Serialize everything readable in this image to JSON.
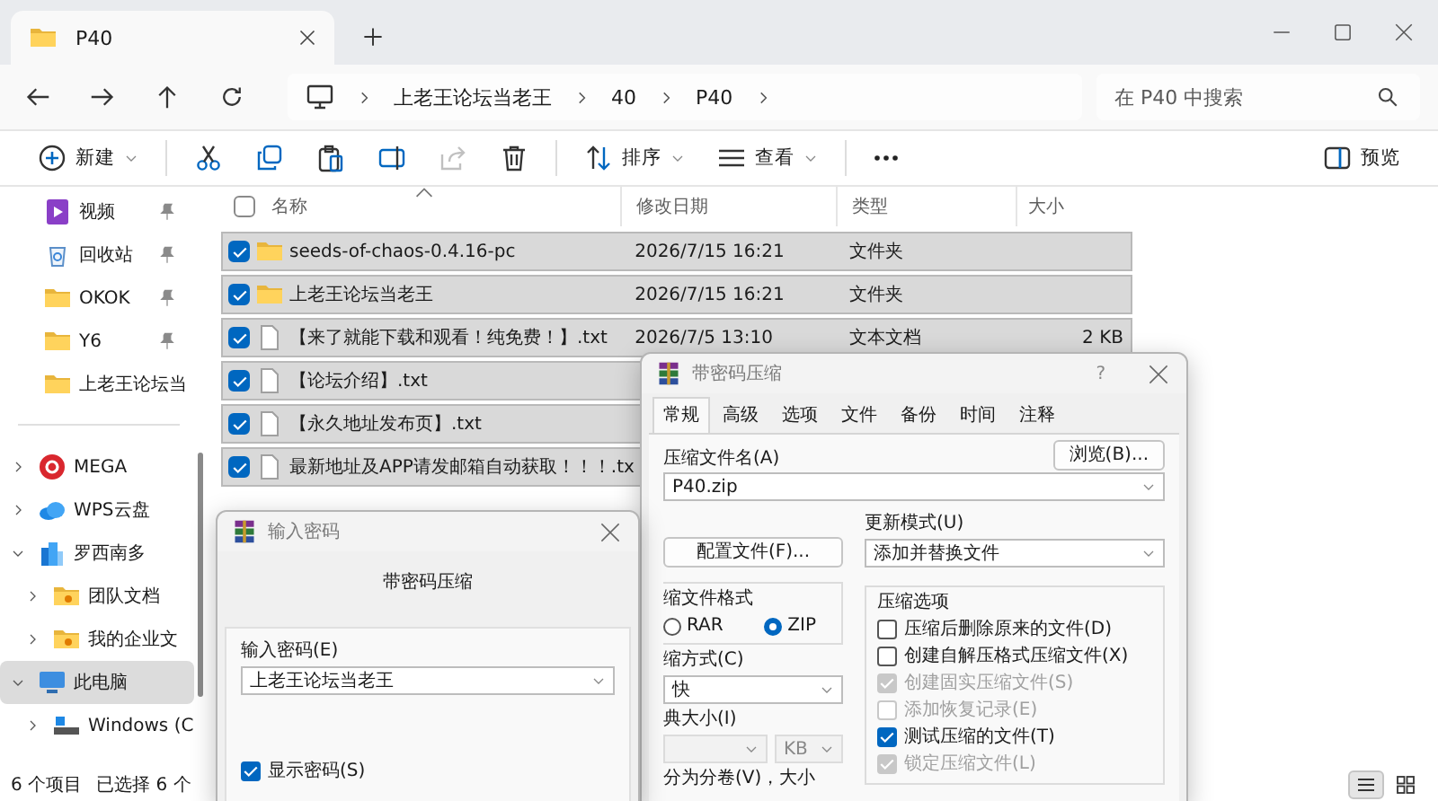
{
  "window": {
    "tab_title": "P40",
    "search_placeholder": "在 P40 中搜索"
  },
  "breadcrumbs": [
    "上老王论坛当老王",
    "40",
    "P40"
  ],
  "toolbar_groups": [
    [
      {
        "kind": "new",
        "label": "新建",
        "disabled": false
      }
    ],
    [
      {
        "kind": "cut",
        "disabled": false
      },
      {
        "kind": "copy",
        "disabled": false
      },
      {
        "kind": "paste",
        "disabled": false
      },
      {
        "kind": "rename",
        "disabled": false
      },
      {
        "kind": "share",
        "disabled": true
      },
      {
        "kind": "delete",
        "disabled": false
      }
    ],
    [
      {
        "kind": "sort",
        "label": "排序",
        "disabled": false
      },
      {
        "kind": "view",
        "label": "查看",
        "disabled": false
      }
    ],
    [
      {
        "kind": "more",
        "disabled": false
      }
    ]
  ],
  "preview": {
    "label": "预览"
  },
  "sidebar": {
    "quick_access": [
      {
        "label": "视频",
        "kind": "video",
        "pinned": true
      },
      {
        "label": "回收站",
        "kind": "recycle",
        "pinned": true
      },
      {
        "label": "OKOK",
        "kind": "folder",
        "pinned": true
      },
      {
        "label": "Y6",
        "kind": "folder",
        "pinned": true
      },
      {
        "label": "上老王论坛当",
        "kind": "folder",
        "pinned": false
      }
    ],
    "tree": [
      {
        "label": "MEGA",
        "kind": "mega",
        "expanded": false,
        "selected": false
      },
      {
        "label": "WPS云盘",
        "kind": "cloud",
        "expanded": false,
        "selected": false
      },
      {
        "label": "罗西南多",
        "kind": "org",
        "expanded": true,
        "selected": false,
        "children": [
          {
            "label": "团队文档",
            "kind": "shared-folder",
            "expanded": false,
            "selected": false
          },
          {
            "label": "我的企业文",
            "kind": "shared-folder",
            "expanded": false,
            "selected": false
          }
        ]
      },
      {
        "label": "此电脑",
        "kind": "pc",
        "expanded": true,
        "selected": true,
        "children": [
          {
            "label": "Windows (C",
            "kind": "drive",
            "expanded": false,
            "selected": false
          }
        ]
      }
    ]
  },
  "file_list": {
    "columns": [
      "名称",
      "修改日期",
      "类型",
      "大小"
    ],
    "header_checked": false,
    "rows": [
      {
        "name": "seeds-of-chaos-0.4.16-pc",
        "date": "2026/7/15 16:21",
        "type": "文件夹",
        "kind": "folder",
        "selected": true
      },
      {
        "name": "上老王论坛当老王",
        "date": "2026/7/15 16:21",
        "type": "文件夹",
        "kind": "folder",
        "selected": true
      },
      {
        "name": "【来了就能下载和观看！纯免费！】.txt",
        "date": "2026/7/5 13:10",
        "type": "文本文档",
        "size": "2 KB",
        "kind": "text",
        "selected": true
      },
      {
        "name": "【论坛介绍】.txt",
        "kind": "text",
        "selected": true
      },
      {
        "name": "【永久地址发布页】.txt",
        "kind": "text",
        "selected": true
      },
      {
        "name": "最新地址及APP请发邮箱自动获取！！！.tx",
        "kind": "text",
        "selected": true
      }
    ]
  },
  "status_bar": {
    "item_count": "6 个项目",
    "selection": "已选择 6 个",
    "view_modes": [
      {
        "kind": "details",
        "selected": true
      },
      {
        "kind": "tiles",
        "selected": false
      }
    ]
  },
  "archive_dialog": {
    "title": "带密码压缩",
    "help": "?",
    "tabs": [
      {
        "label": "常规",
        "selected": true
      },
      {
        "label": "高级",
        "selected": false
      },
      {
        "label": "选项",
        "selected": false
      },
      {
        "label": "文件",
        "selected": false
      },
      {
        "label": "备份",
        "selected": false
      },
      {
        "label": "时间",
        "selected": false
      },
      {
        "label": "注释",
        "selected": false
      }
    ],
    "archive_name_label": "压缩文件名(A)",
    "browse_button": "浏览(B)...",
    "archive_name": "P40.zip",
    "profiles_button": "配置文件(F)...",
    "update_mode_label": "更新模式(U)",
    "update_mode": "添加并替换文件",
    "format_label": "缩文件格式",
    "formats": [
      {
        "label": "RAR",
        "selected": false
      },
      {
        "label": "ZIP",
        "selected": true
      }
    ],
    "method_label": "缩方式(C)",
    "method": "快",
    "dictionary_label": "典大小(I)",
    "dictionary_unit": "KB",
    "dictionary_disabled": true,
    "split_label": "分为分卷(V)，大小",
    "options_label": "压缩选项",
    "options": [
      {
        "label": "压缩后删除原来的文件(D)",
        "checked": false,
        "disabled": false
      },
      {
        "label": "创建自解压格式压缩文件(X)",
        "checked": false,
        "disabled": false
      },
      {
        "label": "创建固实压缩文件(S)",
        "checked": true,
        "disabled": true
      },
      {
        "label": "添加恢复记录(E)",
        "checked": false,
        "disabled": true
      },
      {
        "label": "测试压缩的文件(T)",
        "checked": true,
        "disabled": false
      },
      {
        "label": "锁定压缩文件(L)",
        "checked": true,
        "disabled": true
      }
    ]
  },
  "password_dialog": {
    "title": "输入密码",
    "heading": "带密码压缩",
    "password_label": "输入密码(E)",
    "password": "上老王论坛当老王",
    "show_password": {
      "label": "显示密码(S)",
      "checked": true
    }
  }
}
